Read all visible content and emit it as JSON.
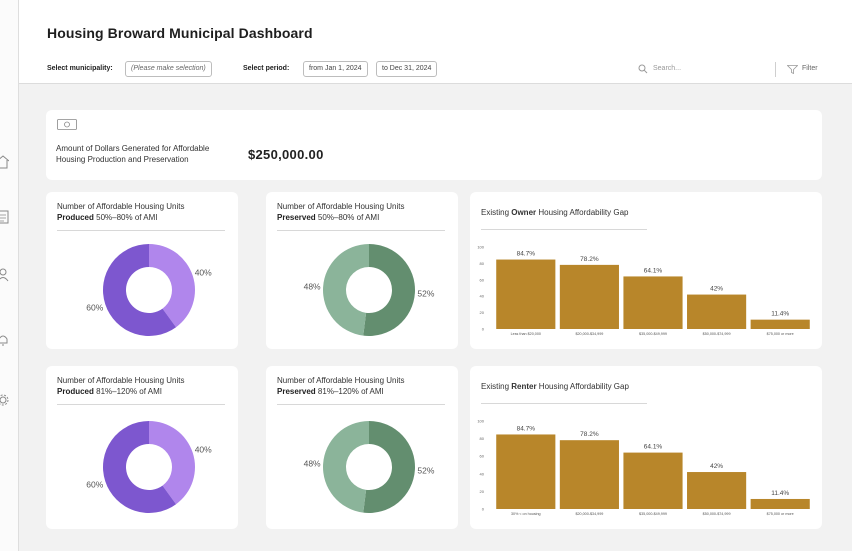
{
  "header": {
    "title": "Housing Broward Municipal Dashboard"
  },
  "filters": {
    "municipality_label": "Select municipality:",
    "municipality_value": "(Please make selection)",
    "period_label": "Select period:",
    "period_from": "from Jan 1, 2024",
    "period_to": "to Dec 31, 2024",
    "search_placeholder": "Search...",
    "filter_label": "Filter"
  },
  "dollars": {
    "caption": "Amount of Dollars Generated for Affordable Housing Production and Preservation",
    "value": "$250,000.00"
  },
  "donuts": [
    {
      "title_prefix": "Number of Affordable Housing Units",
      "title_bold": "Produced",
      "title_rest": " 50%–80% of AMI",
      "segments": [
        {
          "label": "40%",
          "value": 40,
          "color": "#b086ec"
        },
        {
          "label": "60%",
          "value": 60,
          "color": "#7d57cf"
        }
      ]
    },
    {
      "title_prefix": "Number of Affordable Housing Units",
      "title_bold": "Preserved",
      "title_rest": " 50%–80% of AMI",
      "segments": [
        {
          "label": "52%",
          "value": 52,
          "color": "#638e6f"
        },
        {
          "label": "48%",
          "value": 48,
          "color": "#8bb49a"
        }
      ]
    },
    {
      "title_prefix": "Number of Affordable Housing Units",
      "title_bold": "Produced",
      "title_rest": " 81%–120% of AMI",
      "segments": [
        {
          "label": "40%",
          "value": 40,
          "color": "#b086ec"
        },
        {
          "label": "60%",
          "value": 60,
          "color": "#7d57cf"
        }
      ]
    },
    {
      "title_prefix": "Number of Affordable Housing Units",
      "title_bold": "Preserved",
      "title_rest": " 81%–120% of AMI",
      "segments": [
        {
          "label": "52%",
          "value": 52,
          "color": "#638e6f"
        },
        {
          "label": "48%",
          "value": 48,
          "color": "#8bb49a"
        }
      ]
    }
  ],
  "bar_color": "#b8862a",
  "chart_data": [
    {
      "type": "bar",
      "title_prefix": "Existing ",
      "title_bold": "Owner",
      "title_rest": " Housing Affordability Gap",
      "categories": [
        "Less than $20,000",
        "$20,000-$34,999",
        "$35,000-$49,999",
        "$50,000-$74,999",
        "$75,000 or more"
      ],
      "values": [
        84.7,
        78.2,
        64.1,
        42,
        11.4
      ],
      "value_labels": [
        "84.7%",
        "78.2%",
        "64.1%",
        "42%",
        "11.4%"
      ],
      "ylim": [
        0,
        100
      ],
      "yticks": [
        0,
        20,
        40,
        60,
        80,
        100
      ]
    },
    {
      "type": "bar",
      "title_prefix": "Existing ",
      "title_bold": "Renter",
      "title_rest": " Housing Affordability Gap",
      "categories": [
        "30% < on housing",
        "$20,000-$34,999",
        "$35,000-$49,999",
        "$50,000-$74,999",
        "$75,000 or more"
      ],
      "values": [
        84.7,
        78.2,
        64.1,
        42,
        11.4
      ],
      "value_labels": [
        "84.7%",
        "78.2%",
        "64.1%",
        "42%",
        "11.4%"
      ],
      "ylim": [
        0,
        100
      ],
      "yticks": [
        0,
        20,
        40,
        60,
        80,
        100
      ]
    }
  ]
}
